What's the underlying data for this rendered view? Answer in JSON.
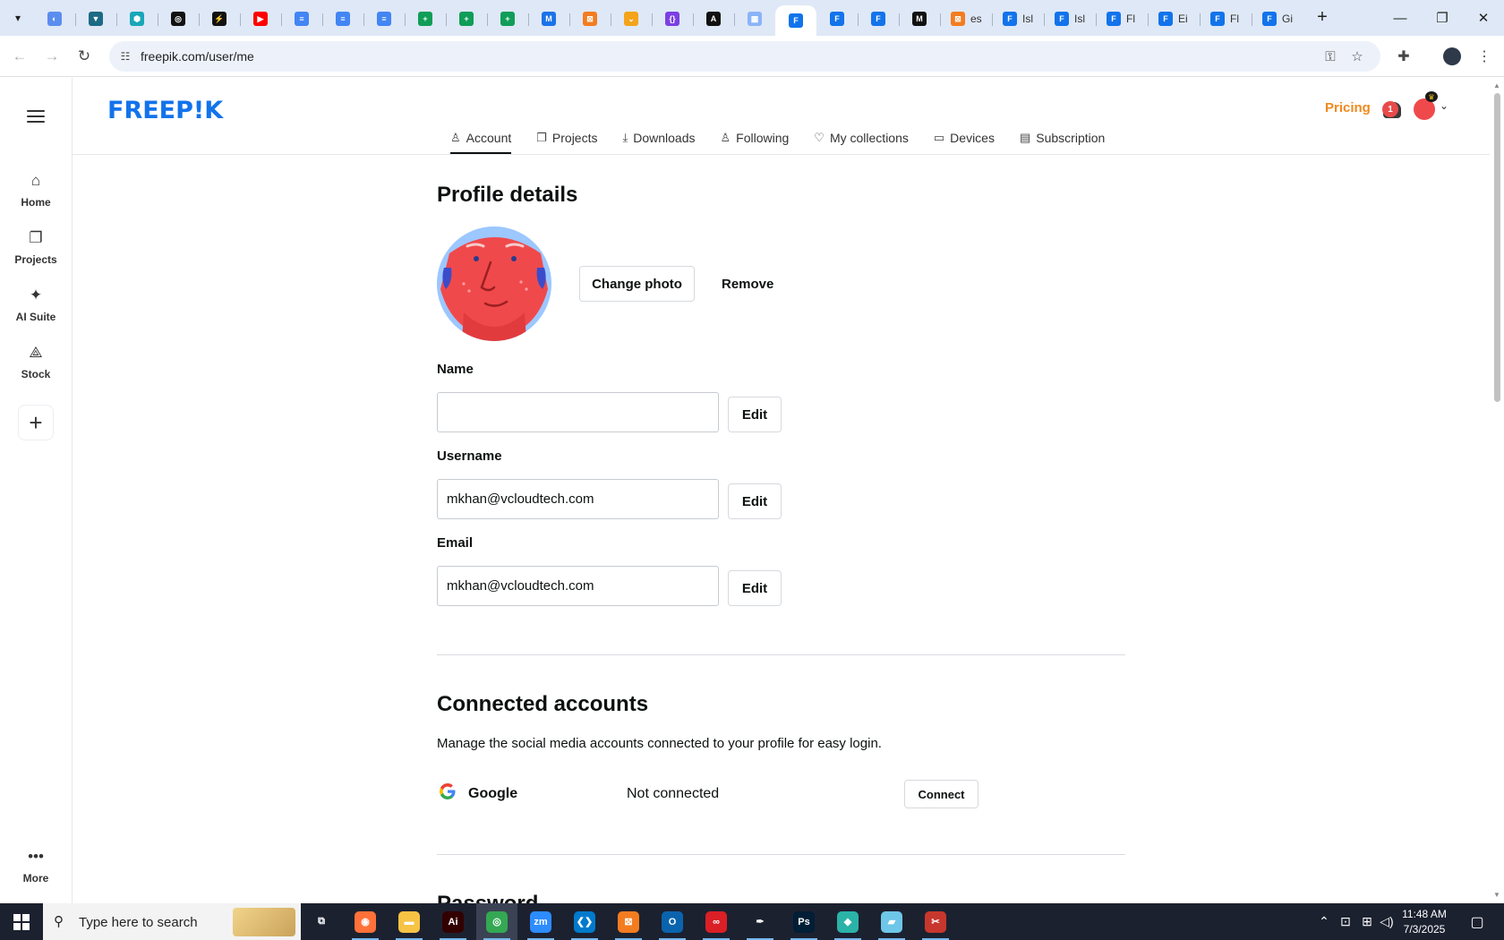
{
  "browser": {
    "tabs_pinned": [
      {
        "icon": "globe-icon",
        "color": "#5b8def",
        "glyph": "◐"
      },
      {
        "icon": "vpn-shield-icon",
        "color": "#1b6b85",
        "glyph": "▼"
      },
      {
        "icon": "hexagon-app-icon",
        "color": "#19a7b8",
        "glyph": "⬢"
      },
      {
        "icon": "openai-icon",
        "color": "#111111",
        "glyph": "◎"
      },
      {
        "icon": "bolt-app-icon",
        "color": "#111111",
        "glyph": "⚡"
      },
      {
        "icon": "youtube-icon",
        "color": "#ff0000",
        "glyph": "▶"
      },
      {
        "icon": "google-docs-icon",
        "color": "#4285f4",
        "glyph": "≡"
      },
      {
        "icon": "google-docs-icon",
        "color": "#4285f4",
        "glyph": "≡"
      },
      {
        "icon": "google-docs-icon",
        "color": "#4285f4",
        "glyph": "≡"
      },
      {
        "icon": "google-sheets-icon",
        "color": "#0f9d58",
        "glyph": "+"
      },
      {
        "icon": "google-sheets-icon",
        "color": "#0f9d58",
        "glyph": "+"
      },
      {
        "icon": "google-sheets-icon",
        "color": "#0f9d58",
        "glyph": "+"
      },
      {
        "icon": "keyword-tool-icon",
        "color": "#1a73e8",
        "glyph": "M"
      },
      {
        "icon": "xampp-icon",
        "color": "#f47c20",
        "glyph": "⊠"
      },
      {
        "icon": "bird-app-icon",
        "color": "#f4a31a",
        "glyph": "⌄"
      },
      {
        "icon": "code-braces-icon",
        "color": "#7b3fe4",
        "glyph": "{}"
      },
      {
        "icon": "text-app-icon",
        "color": "#111111",
        "glyph": "A"
      },
      {
        "icon": "grid-app-icon",
        "color": "#8ab4f8",
        "glyph": "▦"
      },
      {
        "icon": "freepik-tab-icon",
        "color": "#1273eb",
        "glyph": "F"
      },
      {
        "icon": "freepik-tab-icon",
        "color": "#1273eb",
        "glyph": "F"
      },
      {
        "icon": "freepik-tab-icon",
        "color": "#1273eb",
        "glyph": "F"
      },
      {
        "icon": "medium-icon",
        "color": "#111111",
        "glyph": "M"
      }
    ],
    "tabs_titled": [
      {
        "icon": "xampp-icon",
        "color": "#f47c20",
        "glyph": "⊠",
        "title": "es"
      },
      {
        "icon": "freepik-tab-icon",
        "color": "#1273eb",
        "glyph": "F",
        "title": "Isl"
      },
      {
        "icon": "freepik-tab-icon",
        "color": "#1273eb",
        "glyph": "F",
        "title": "Isl"
      },
      {
        "icon": "freepik-tab-icon",
        "color": "#1273eb",
        "glyph": "F",
        "title": "Fl"
      },
      {
        "icon": "freepik-tab-icon",
        "color": "#1273eb",
        "glyph": "F",
        "title": "Ei"
      },
      {
        "icon": "freepik-tab-icon",
        "color": "#1273eb",
        "glyph": "F",
        "title": "Fl"
      },
      {
        "icon": "freepik-tab-icon",
        "color": "#1273eb",
        "glyph": "F",
        "title": "Gi"
      }
    ],
    "active_tab_index": 18,
    "url": "freepik.com/user/me"
  },
  "rail": {
    "items": [
      {
        "label": "Home",
        "icon": "home-icon",
        "glyph": "⌂"
      },
      {
        "label": "Projects",
        "icon": "projects-icon",
        "glyph": "❐"
      },
      {
        "label": "AI Suite",
        "icon": "ai-sparkle-icon",
        "glyph": "✦"
      },
      {
        "label": "Stock",
        "icon": "stock-shapes-icon",
        "glyph": "⟁"
      }
    ],
    "more_label": "More"
  },
  "header": {
    "logo": "FREEP!K",
    "pricing": "Pricing",
    "notification_count": "1"
  },
  "subnav": [
    {
      "label": "Account",
      "icon": "user-icon",
      "glyph": "♙",
      "active": true
    },
    {
      "label": "Projects",
      "icon": "projects-icon",
      "glyph": "❐",
      "active": false
    },
    {
      "label": "Downloads",
      "icon": "download-icon",
      "glyph": "⤓",
      "active": false
    },
    {
      "label": "Following",
      "icon": "following-icon",
      "glyph": "♙",
      "active": false
    },
    {
      "label": "My collections",
      "icon": "heart-icon",
      "glyph": "♡",
      "active": false
    },
    {
      "label": "Devices",
      "icon": "laptop-icon",
      "glyph": "▭",
      "active": false
    },
    {
      "label": "Subscription",
      "icon": "card-icon",
      "glyph": "▤",
      "active": false
    }
  ],
  "profile": {
    "title": "Profile details",
    "change_photo": "Change photo",
    "remove": "Remove",
    "name_label": "Name",
    "name_value": "",
    "username_label": "Username",
    "username_value": "mkhan@vcloudtech.com",
    "email_label": "Email",
    "email_value": "mkhan@vcloudtech.com",
    "edit_label": "Edit"
  },
  "connected": {
    "title": "Connected accounts",
    "description": "Manage the social media accounts connected to your profile for easy login.",
    "provider": "Google",
    "status": "Not connected",
    "connect_label": "Connect"
  },
  "password_title": "Password",
  "taskbar": {
    "search_placeholder": "Type here to search",
    "apps": [
      {
        "icon": "task-view-icon",
        "color": "#1c2130",
        "glyph": "⧉"
      },
      {
        "icon": "firefox-icon",
        "color": "#ff7139",
        "glyph": "◉"
      },
      {
        "icon": "file-explorer-icon",
        "color": "#f6c344",
        "glyph": "▬"
      },
      {
        "icon": "illustrator-icon",
        "color": "#330000",
        "glyph": "Ai"
      },
      {
        "icon": "chrome-icon",
        "color": "#34a853",
        "glyph": "◎"
      },
      {
        "icon": "zoom-icon",
        "color": "#2d8cff",
        "glyph": "zm"
      },
      {
        "icon": "vscode-icon",
        "color": "#007acc",
        "glyph": "❮❯"
      },
      {
        "icon": "xampp-icon",
        "color": "#f47c20",
        "glyph": "⊠"
      },
      {
        "icon": "outlook-icon",
        "color": "#0a64ad",
        "glyph": "O"
      },
      {
        "icon": "creative-cloud-icon",
        "color": "#da1f26",
        "glyph": "∞"
      },
      {
        "icon": "pen-tool-icon",
        "color": "#1c2130",
        "glyph": "✒"
      },
      {
        "icon": "photoshop-icon",
        "color": "#001e36",
        "glyph": "Ps"
      },
      {
        "icon": "diamond-app-icon",
        "color": "#2bb3a8",
        "glyph": "◆"
      },
      {
        "icon": "notes-app-icon",
        "color": "#6ec6e8",
        "glyph": "▰"
      },
      {
        "icon": "snip-tool-icon",
        "color": "#c8372d",
        "glyph": "✂"
      }
    ],
    "time": "11:48 AM",
    "date": "7/3/2025"
  },
  "colors": {
    "brand": "#1273eb",
    "pricing": "#f08a1d",
    "avatar": "#f0494b"
  }
}
